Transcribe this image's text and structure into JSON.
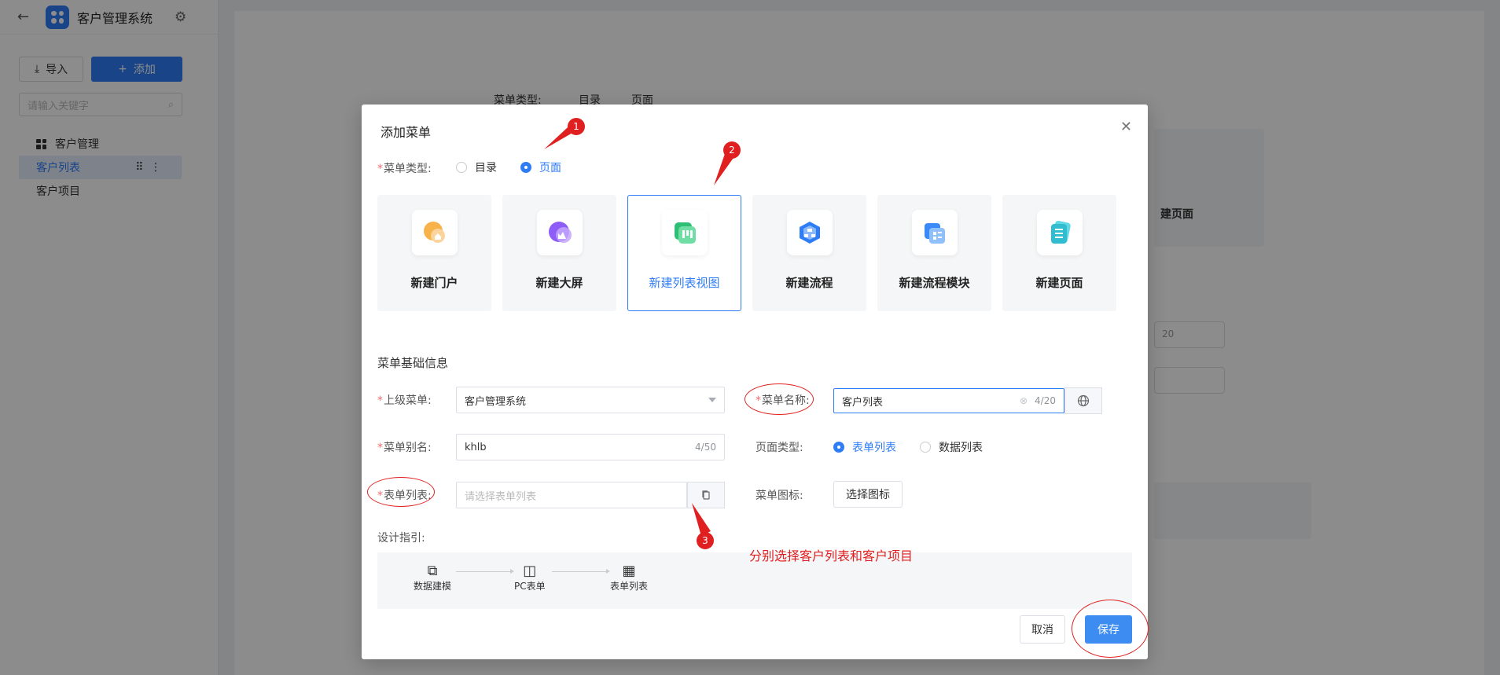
{
  "app": {
    "title": "客户管理系统"
  },
  "sidebar": {
    "import_label": "导入",
    "add_label": "添加",
    "search_placeholder": "请输入关键字",
    "items": [
      {
        "label": "客户管理"
      },
      {
        "label": "客户列表"
      },
      {
        "label": "客户项目"
      }
    ]
  },
  "background": {
    "menu_type_label": "菜单类型:",
    "opt_dir": "目录",
    "opt_page": "页面",
    "ghost_card": "建页面",
    "ghost_count": "20"
  },
  "modal": {
    "title": "添加菜单",
    "menu_type": {
      "label": "菜单类型:",
      "options": [
        "目录",
        "页面"
      ],
      "selected": "页面"
    },
    "cards": [
      {
        "label": "新建门户",
        "icon": "portal-icon"
      },
      {
        "label": "新建大屏",
        "icon": "screen-icon"
      },
      {
        "label": "新建列表视图",
        "icon": "list-view-icon"
      },
      {
        "label": "新建流程",
        "icon": "process-icon"
      },
      {
        "label": "新建流程模块",
        "icon": "process-module-icon"
      },
      {
        "label": "新建页面",
        "icon": "page-icon"
      }
    ],
    "selected_card": "新建列表视图",
    "section_title": "菜单基础信息",
    "parent_menu": {
      "label": "上级菜单:",
      "value": "客户管理系统"
    },
    "menu_name": {
      "label": "菜单名称:",
      "value": "客户列表",
      "count": "4/20"
    },
    "menu_alias": {
      "label": "菜单别名:",
      "value": "khlb",
      "count": "4/50"
    },
    "page_type": {
      "label": "页面类型:",
      "options": [
        "表单列表",
        "数据列表"
      ],
      "selected": "表单列表"
    },
    "form_list": {
      "label": "表单列表:",
      "placeholder": "请选择表单列表"
    },
    "menu_icon": {
      "label": "菜单图标:",
      "button": "选择图标"
    },
    "guide": {
      "label": "设计指引:",
      "steps": [
        "数据建模",
        "PC表单",
        "表单列表"
      ]
    },
    "cancel": "取消",
    "save": "保存"
  },
  "annotations": {
    "badges": [
      "1",
      "2",
      "3"
    ],
    "note": "分别选择客户列表和客户项目",
    "color": "#e02020"
  }
}
